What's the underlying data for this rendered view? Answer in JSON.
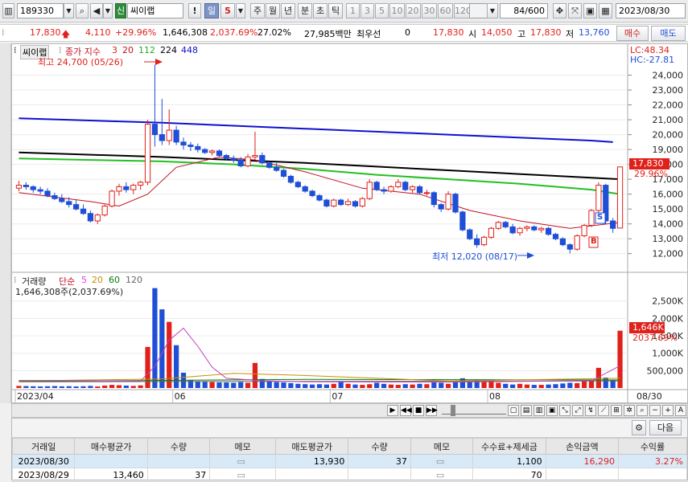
{
  "toolbar": {
    "code": "189330",
    "badge": "신",
    "name": "씨이랩",
    "exclaim": "!",
    "day_label": "일",
    "day_num": "5",
    "periods": [
      "주",
      "월",
      "년",
      "분",
      "초",
      "틱"
    ],
    "minutes": [
      "1",
      "3",
      "5",
      "10",
      "20",
      "30",
      "60",
      "120"
    ],
    "count": "84",
    "count_total": "/600",
    "date": "2023/08/30"
  },
  "quote": {
    "price": "17,830",
    "change": "4,110",
    "change_pct": "+29.96%",
    "volume": "1,646,308",
    "volume_pct": "2,037.69%",
    "turnover_pct": "27.02%",
    "amount": "27,985백만",
    "pref_label": "최우선",
    "pref_value": "0",
    "bid": "17,830",
    "open_label": "시",
    "open": "14,050",
    "high_label": "고",
    "high": "17,830",
    "low_label": "저",
    "low": "13,760",
    "buy_button": "매수",
    "sell_button": "매도"
  },
  "colors": {
    "up": "#e0201a",
    "down": "#1f4fd6",
    "ma3": "#e0201a",
    "ma20": "#c01020",
    "ma112": "#22c022",
    "ma224": "#000000",
    "ma448": "#1010d0"
  },
  "price_panel": {
    "title": "씨이랩",
    "legend_prefix": "종가 지수",
    "ma": [
      "3",
      "20",
      "112",
      "224",
      "448"
    ],
    "lc": "LC:48.34",
    "hc": "HC:-27.81",
    "max_note": "최고 24,700 (05/26)",
    "min_note": "최저 12,020 (08/17)",
    "last_price": "17,830",
    "last_pct": "29.96%",
    "marker_s": "S",
    "marker_b": "B"
  },
  "volume_panel": {
    "title": "거래량",
    "legend_prefix": "단순",
    "ma": [
      "5",
      "20",
      "60",
      "120"
    ],
    "summary": "1,646,308주(2,037.69%)",
    "last_vol": "1,646K",
    "last_pct": "2037.69%"
  },
  "chart_data": [
    {
      "type": "candlestick",
      "title": "씨이랩",
      "ylim": [
        11500,
        25000
      ],
      "y_ticks": [
        "24,000",
        "23,000",
        "22,000",
        "21,000",
        "20,000",
        "19,000",
        "18,000",
        "17,000",
        "16,000",
        "15,000",
        "14,000",
        "13,000",
        "12,000"
      ],
      "x_ticks": [
        "2023/04",
        "06",
        "07",
        "08",
        "08/30"
      ],
      "candles": [
        [
          16400,
          16900,
          16200,
          16600
        ],
        [
          16600,
          16800,
          16300,
          16500
        ],
        [
          16500,
          16600,
          16100,
          16300
        ],
        [
          16300,
          16500,
          16000,
          16200
        ],
        [
          16200,
          16400,
          15800,
          15900
        ],
        [
          15900,
          16100,
          15600,
          15700
        ],
        [
          15700,
          16000,
          15400,
          15500
        ],
        [
          15500,
          15800,
          15100,
          15300
        ],
        [
          15300,
          15600,
          14900,
          15000
        ],
        [
          15000,
          15300,
          14600,
          14700
        ],
        [
          14700,
          14900,
          14100,
          14200
        ],
        [
          14200,
          14700,
          14000,
          14600
        ],
        [
          14600,
          15300,
          14500,
          15200
        ],
        [
          15200,
          16300,
          15100,
          16200
        ],
        [
          16200,
          16700,
          15900,
          16500
        ],
        [
          16500,
          16800,
          16100,
          16300
        ],
        [
          16300,
          16700,
          16000,
          16600
        ],
        [
          16600,
          16900,
          16300,
          16800
        ],
        [
          16800,
          21000,
          16600,
          20700
        ],
        [
          20700,
          24700,
          19200,
          20000
        ],
        [
          20000,
          22400,
          19300,
          19600
        ],
        [
          19600,
          21700,
          19300,
          20300
        ],
        [
          20300,
          20600,
          19300,
          19500
        ],
        [
          19500,
          19800,
          19000,
          19300
        ],
        [
          19300,
          19500,
          18900,
          19200
        ],
        [
          19200,
          19400,
          18800,
          19000
        ],
        [
          19000,
          19100,
          18700,
          18800
        ],
        [
          18800,
          19000,
          18600,
          18900
        ],
        [
          18900,
          19000,
          18500,
          18600
        ],
        [
          18600,
          18700,
          18300,
          18400
        ],
        [
          18400,
          18600,
          18100,
          18300
        ],
        [
          18300,
          18500,
          17800,
          17900
        ],
        [
          17900,
          18700,
          17800,
          18500
        ],
        [
          18500,
          20200,
          18300,
          18600
        ],
        [
          18600,
          18800,
          18000,
          18100
        ],
        [
          18100,
          18200,
          17700,
          17800
        ],
        [
          17800,
          18100,
          17500,
          17600
        ],
        [
          17600,
          17700,
          17100,
          17200
        ],
        [
          17200,
          17300,
          16700,
          16800
        ],
        [
          16800,
          16900,
          16400,
          16500
        ],
        [
          16500,
          16600,
          16100,
          16200
        ],
        [
          16200,
          16300,
          15800,
          15900
        ],
        [
          15900,
          16000,
          15500,
          15600
        ],
        [
          15600,
          15700,
          15100,
          15200
        ],
        [
          15200,
          15700,
          15100,
          15600
        ],
        [
          15600,
          15700,
          15200,
          15300
        ],
        [
          15300,
          15700,
          15200,
          15500
        ],
        [
          15500,
          15600,
          15100,
          15200
        ],
        [
          15200,
          15800,
          15100,
          15700
        ],
        [
          15700,
          17000,
          15600,
          16800
        ],
        [
          16800,
          16900,
          16200,
          16300
        ],
        [
          16300,
          16500,
          16000,
          16200
        ],
        [
          16200,
          16600,
          16100,
          16500
        ],
        [
          16500,
          17000,
          16400,
          16800
        ],
        [
          16800,
          16900,
          16200,
          16300
        ],
        [
          16300,
          16600,
          16100,
          16500
        ],
        [
          16500,
          16600,
          16000,
          16100
        ],
        [
          16100,
          16300,
          15900,
          16100
        ],
        [
          16100,
          16200,
          15100,
          15300
        ],
        [
          15300,
          15400,
          14800,
          15000
        ],
        [
          15000,
          16200,
          14900,
          16000
        ],
        [
          16000,
          16100,
          14700,
          14800
        ],
        [
          14800,
          14900,
          13500,
          13600
        ],
        [
          13600,
          13700,
          12900,
          13000
        ],
        [
          13000,
          13300,
          12400,
          12600
        ],
        [
          12600,
          13200,
          12500,
          13100
        ],
        [
          13100,
          13800,
          13000,
          13700
        ],
        [
          13700,
          14200,
          13600,
          14100
        ],
        [
          14100,
          14200,
          13700,
          13800
        ],
        [
          13800,
          14000,
          13300,
          13400
        ],
        [
          13400,
          13800,
          13200,
          13700
        ],
        [
          13700,
          13900,
          13500,
          13800
        ],
        [
          13800,
          13900,
          13500,
          13600
        ],
        [
          13600,
          13800,
          13400,
          13700
        ],
        [
          13700,
          13800,
          13200,
          13300
        ],
        [
          13300,
          13400,
          12900,
          13000
        ],
        [
          13000,
          13100,
          12500,
          12600
        ],
        [
          12600,
          12700,
          12020,
          12300
        ],
        [
          12300,
          13300,
          12200,
          13200
        ],
        [
          13200,
          14000,
          13100,
          13900
        ],
        [
          13900,
          15000,
          13800,
          14900
        ],
        [
          14900,
          16800,
          14700,
          16600
        ],
        [
          16600,
          16700,
          14000,
          14200
        ],
        [
          14200,
          14400,
          13400,
          13700
        ],
        [
          13720,
          17830,
          13760,
          17830
        ]
      ],
      "ma": {
        "20": [
          [
            0,
            16100
          ],
          [
            10,
            15500
          ],
          [
            14,
            15200
          ],
          [
            18,
            16000
          ],
          [
            22,
            17800
          ],
          [
            28,
            18500
          ],
          [
            33,
            18300
          ],
          [
            40,
            17500
          ],
          [
            48,
            16400
          ],
          [
            56,
            16000
          ],
          [
            63,
            14900
          ],
          [
            70,
            14200
          ],
          [
            77,
            13700
          ],
          [
            84,
            14100
          ]
        ],
        "112": [
          [
            0,
            18400
          ],
          [
            10,
            18300
          ],
          [
            20,
            18200
          ],
          [
            30,
            18000
          ],
          [
            40,
            17700
          ],
          [
            50,
            17300
          ],
          [
            60,
            17000
          ],
          [
            70,
            16700
          ],
          [
            80,
            16300
          ],
          [
            84,
            16000
          ]
        ],
        "224": [
          [
            0,
            18800
          ],
          [
            20,
            18500
          ],
          [
            40,
            18100
          ],
          [
            60,
            17600
          ],
          [
            80,
            17100
          ],
          [
            84,
            17000
          ]
        ],
        "448": [
          [
            0,
            21100
          ],
          [
            20,
            20800
          ],
          [
            40,
            20400
          ],
          [
            60,
            20000
          ],
          [
            80,
            19600
          ],
          [
            83,
            19500
          ]
        ]
      }
    },
    {
      "type": "bar",
      "title": "거래량",
      "ylim": [
        0,
        3000
      ],
      "unit": "K",
      "y_ticks": [
        "2,500K",
        "2,000K",
        "1,500K",
        "1,000K",
        "500,000"
      ],
      "values": [
        60,
        55,
        50,
        45,
        50,
        55,
        48,
        52,
        45,
        50,
        60,
        45,
        70,
        90,
        80,
        70,
        60,
        75,
        1180,
        2870,
        2260,
        1900,
        1230,
        440,
        220,
        190,
        180,
        170,
        160,
        160,
        150,
        170,
        150,
        720,
        260,
        200,
        170,
        160,
        140,
        120,
        110,
        100,
        110,
        100,
        120,
        180,
        120,
        100,
        90,
        110,
        150,
        120,
        100,
        90,
        110,
        100,
        120,
        110,
        160,
        150,
        120,
        180,
        280,
        200,
        230,
        200,
        220,
        150,
        120,
        100,
        120,
        100,
        90,
        90,
        100,
        110,
        130,
        150,
        140,
        200,
        240,
        580,
        300,
        220,
        1646
      ],
      "ma5": [
        [
          0,
          220
        ],
        [
          17,
          200
        ],
        [
          19,
          620
        ],
        [
          21,
          1370
        ],
        [
          23,
          1720
        ],
        [
          25,
          1200
        ],
        [
          27,
          600
        ],
        [
          29,
          280
        ],
        [
          34,
          210
        ],
        [
          40,
          180
        ],
        [
          60,
          170
        ],
        [
          80,
          210
        ],
        [
          84,
          640
        ]
      ],
      "ma20": [
        [
          0,
          200
        ],
        [
          20,
          260
        ],
        [
          30,
          420
        ],
        [
          40,
          360
        ],
        [
          60,
          200
        ],
        [
          84,
          280
        ]
      ],
      "ma60": [
        [
          0,
          190
        ],
        [
          40,
          250
        ],
        [
          84,
          230
        ]
      ],
      "ma120": [
        [
          0,
          180
        ],
        [
          84,
          200
        ]
      ]
    }
  ],
  "scroll": {
    "zoom_icons": [
      "−",
      "+",
      "A"
    ]
  },
  "table": {
    "next_button": "다음",
    "headers": [
      "거래일",
      "매수평균가",
      "수량",
      "메모",
      "매도평균가",
      "수량",
      "메모",
      "수수료+제세금",
      "손익금액",
      "수익률"
    ],
    "rows": [
      [
        "2023/08/30",
        "",
        "",
        "",
        "13,930",
        "37",
        "",
        "1,100",
        "16,290",
        "3.27%"
      ],
      [
        "2023/08/29",
        "13,460",
        "37",
        "",
        "",
        "",
        "",
        "70",
        "",
        ""
      ]
    ]
  }
}
